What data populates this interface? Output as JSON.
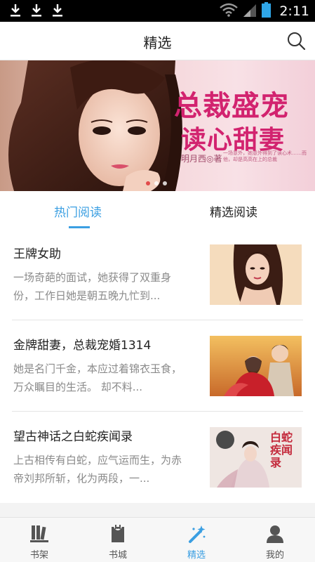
{
  "status_bar": {
    "time": "2:11",
    "notification_icons": [
      "download-icon",
      "download-icon",
      "download-icon"
    ],
    "system_icons": [
      "wifi-icon",
      "signal-icon",
      "battery-icon"
    ]
  },
  "header": {
    "title": "精选",
    "search_icon": "search-icon"
  },
  "banner": {
    "title_line1": "总裁盛宠",
    "title_line2": "读心甜妻",
    "author": "明月西◎著",
    "fine_print": "一场意外，她意外得到了读心术……而他，却是高高在上的总裁",
    "slide_count": 3,
    "active_slide": 1
  },
  "tabs": [
    {
      "label": "热门阅读",
      "active": true
    },
    {
      "label": "精选阅读",
      "active": false
    }
  ],
  "books": [
    {
      "title": "王牌女助",
      "description": "一场奇葩的面试，她获得了双重身份，工作日她是朝五晚九忙到..."
    },
    {
      "title": "金牌甜妻，总裁宠婚1314",
      "description": "她是名门千金，本应过着锦衣玉食，万众瞩目的生活。 却不料..."
    },
    {
      "title": "望古神话之白蛇疾闻录",
      "description": "上古相传有白蛇，应气运而生，为赤帝刘邦所斩，化为两段，一...",
      "cover_text": "白蛇疾闻录"
    }
  ],
  "bottom_nav": [
    {
      "label": "书架",
      "icon": "bookshelf-icon",
      "active": false
    },
    {
      "label": "书城",
      "icon": "bookstore-icon",
      "active": false
    },
    {
      "label": "精选",
      "icon": "magic-wand-icon",
      "active": true
    },
    {
      "label": "我的",
      "icon": "profile-icon",
      "active": false
    }
  ],
  "colors": {
    "accent": "#3b9fe2",
    "banner_title": "#d2236f",
    "status_bar": "#000000"
  }
}
